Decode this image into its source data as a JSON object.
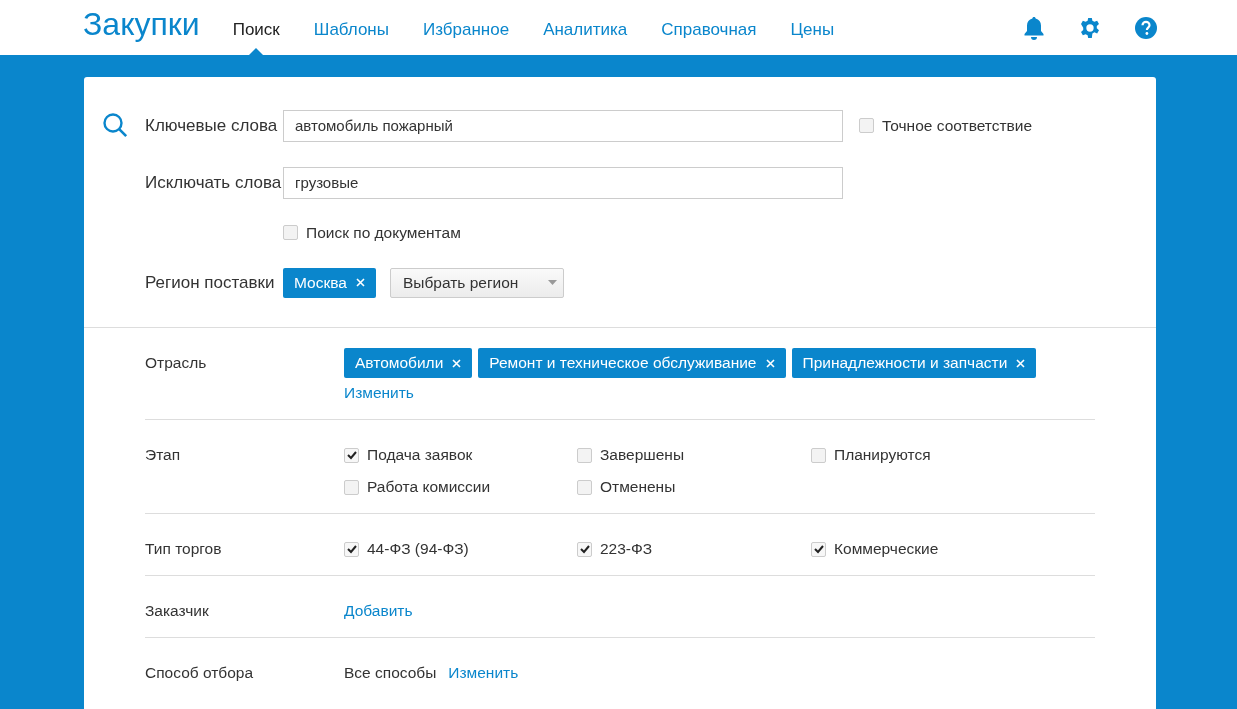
{
  "header": {
    "logo": "Закупки",
    "tabs": [
      {
        "label": "Поиск",
        "selected": true
      },
      {
        "label": "Шаблоны",
        "selected": false
      },
      {
        "label": "Избранное",
        "selected": false
      },
      {
        "label": "Аналитика",
        "selected": false
      },
      {
        "label": "Справочная",
        "selected": false
      },
      {
        "label": "Цены",
        "selected": false
      }
    ]
  },
  "search": {
    "keywords": {
      "label": "Ключевые слова",
      "value": "автомобиль пожарный"
    },
    "exact_match": {
      "label": "Точное соответствие",
      "checked": false
    },
    "exclude": {
      "label": "Исключать слова",
      "value": "грузовые"
    },
    "search_docs": {
      "label": "Поиск по документам",
      "checked": false
    },
    "region": {
      "label": "Регион поставки",
      "tags": [
        "Москва"
      ],
      "dropdown": "Выбрать регион"
    }
  },
  "filters": [
    {
      "kind": "tags",
      "label": "Отрасль",
      "tags": [
        "Автомобили",
        "Ремонт и техническое обслуживание",
        "Принадлежности и запчасти"
      ],
      "link": "Изменить"
    },
    {
      "kind": "checkboxes",
      "label": "Этап",
      "options": [
        {
          "label": "Подача заявок",
          "checked": true
        },
        {
          "label": "Завершены",
          "checked": false
        },
        {
          "label": "Планируются",
          "checked": false
        },
        {
          "label": "Работа комиссии",
          "checked": false
        },
        {
          "label": "Отменены",
          "checked": false
        }
      ]
    },
    {
      "kind": "checkboxes",
      "label": "Тип торгов",
      "options": [
        {
          "label": "44-ФЗ (94-ФЗ)",
          "checked": true
        },
        {
          "label": "223-ФЗ",
          "checked": true
        },
        {
          "label": "Коммерческие",
          "checked": true
        }
      ]
    },
    {
      "kind": "link",
      "label": "Заказчик",
      "link": "Добавить"
    },
    {
      "kind": "value_link",
      "label": "Способ отбора",
      "value": "Все способы",
      "link": "Изменить"
    }
  ]
}
